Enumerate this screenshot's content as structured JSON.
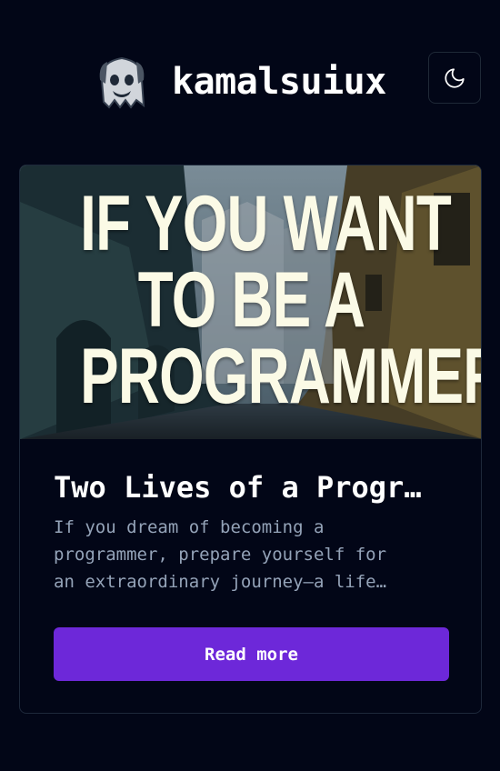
{
  "header": {
    "brand": "kamalsuiux",
    "logo_icon": "ghost-icon",
    "theme_toggle_icon": "moon-icon"
  },
  "post": {
    "image_lines": [
      "IF YOU WANT",
      "TO BE A",
      "PROGRAMMER"
    ],
    "title": "Two Lives of a Progr…",
    "excerpt_lines": [
      "If you dream of becoming a",
      "programmer, prepare yourself for",
      "an extraordinary journey—a life…"
    ],
    "button_label": "Read more"
  },
  "colors": {
    "background": "#020617",
    "accent": "#6d28d9",
    "muted_text": "#94a3b8"
  }
}
